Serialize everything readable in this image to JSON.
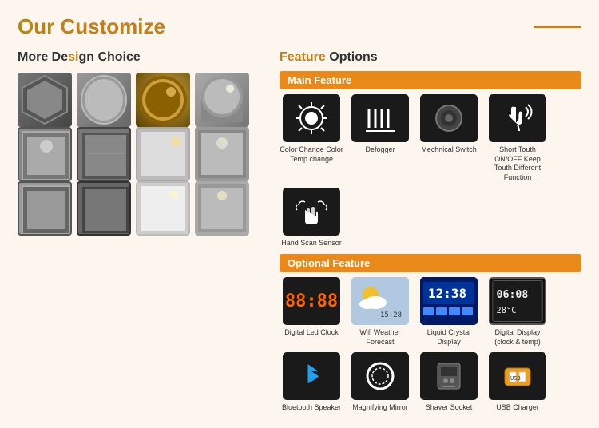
{
  "header": {
    "title": "Our Customize",
    "title_plain": "Our ",
    "title_colored": "Customize"
  },
  "left": {
    "title": "More Design Choice",
    "title_highlight": "si"
  },
  "right": {
    "title": "Feature Options",
    "title_colored": "Feature",
    "main_feature": {
      "header": "Main Feature",
      "items": [
        {
          "label": "Color Change\nColor Temp.change"
        },
        {
          "label": "Defogger"
        },
        {
          "label": "Mechnical\nSwitch"
        },
        {
          "label": "Short Touth ON/OFF\nKeep Touth Different\nFunction"
        },
        {
          "label": "Hand Scan Sensor"
        }
      ]
    },
    "optional_feature": {
      "header": "Optional Feature",
      "items": [
        {
          "label": "Digital Led Clock"
        },
        {
          "label": "Wifi Weather Forecast"
        },
        {
          "label": "Liquid Crystal Display"
        },
        {
          "label": "Digital Display\n(clock & temp)"
        },
        {
          "label": "Bluetooth Speaker"
        },
        {
          "label": "Magnifying Mirror"
        },
        {
          "label": "Shaver Socket"
        },
        {
          "label": "USB Charger"
        }
      ]
    }
  }
}
